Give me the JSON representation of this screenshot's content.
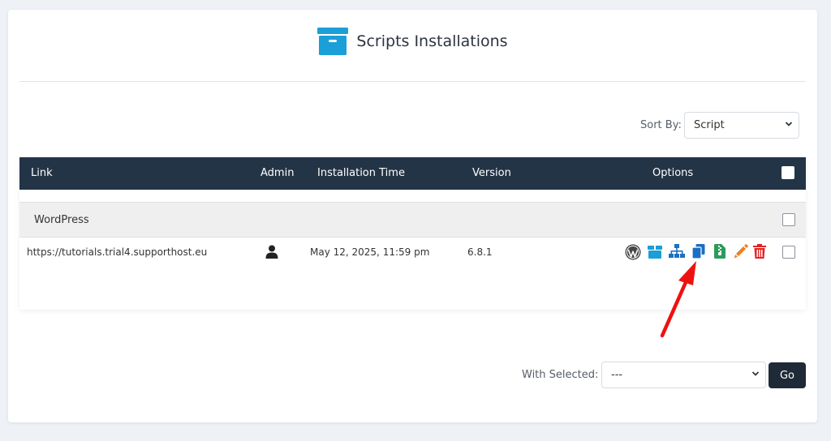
{
  "header": {
    "title": "Scripts Installations",
    "icon": "archive-box-icon"
  },
  "sort": {
    "label": "Sort By:",
    "value": "Script"
  },
  "table": {
    "columns": [
      "Link",
      "Admin",
      "Installation Time",
      "Version",
      "Options"
    ],
    "group": "WordPress",
    "rows": [
      {
        "link": "https://tutorials.trial4.supporthost.eu",
        "admin_icon": "user-icon",
        "time": "May 12, 2025, 11:59 pm",
        "version": "6.8.1",
        "option_icons": [
          "wordpress-icon",
          "backup-box-icon",
          "staging-sitemap-icon",
          "clone-copy-icon",
          "file-zip-icon",
          "edit-pencil-icon",
          "delete-trash-icon"
        ]
      }
    ]
  },
  "bulk": {
    "label": "With Selected:",
    "value": "---",
    "go": "Go"
  },
  "colors": {
    "header_bg": "#243447",
    "accent_blue": "#1a9fd8",
    "link_blue": "#1a6fc4",
    "green": "#2a9d5c",
    "orange": "#f07d20",
    "red": "#e02424",
    "arrow_red": "#ee1111"
  }
}
